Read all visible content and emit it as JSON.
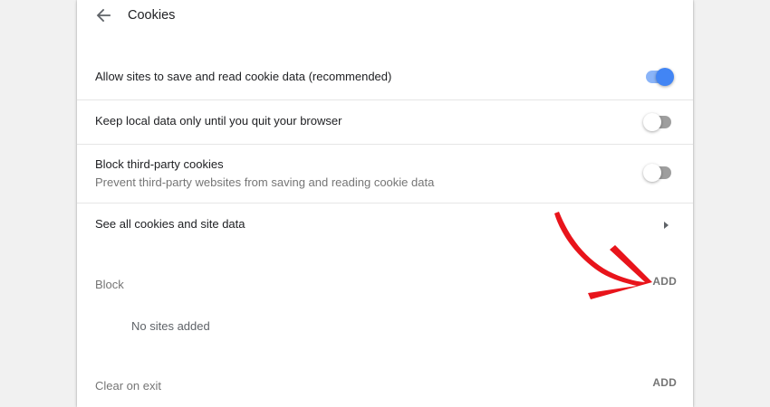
{
  "header": {
    "title": "Cookies",
    "back_icon": "arrow-back-icon"
  },
  "settings": [
    {
      "label": "Allow sites to save and read cookie data (recommended)",
      "enabled": true
    },
    {
      "label": "Keep local data only until you quit your browser",
      "enabled": false
    },
    {
      "label": "Block third-party cookies",
      "sublabel": "Prevent third-party websites from saving and reading cookie data",
      "enabled": false
    }
  ],
  "see_all": {
    "label": "See all cookies and site data",
    "icon": "chevron-right-icon"
  },
  "block": {
    "title": "Block",
    "add_label": "ADD",
    "empty_text": "No sites added"
  },
  "clear_on_exit": {
    "title": "Clear on exit",
    "add_label": "ADD"
  },
  "colors": {
    "toggle_on_track": "#8ab4f8",
    "toggle_on_knob": "#4285f4",
    "toggle_off_track": "#9e9e9e",
    "toggle_off_knob": "#ffffff",
    "annotation_arrow": "#e8141b"
  }
}
